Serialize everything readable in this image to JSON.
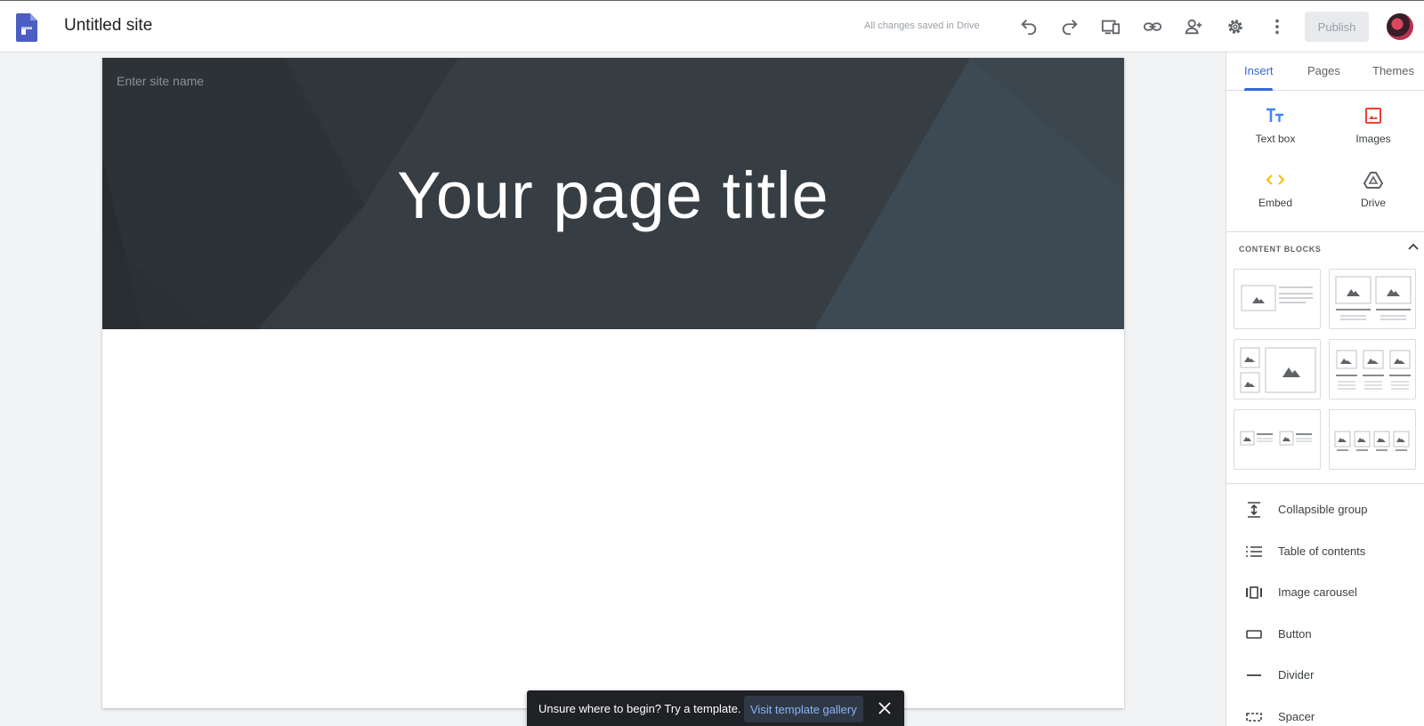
{
  "app": {
    "site_title": "Untitled site",
    "save_status": "All changes saved in Drive",
    "publish_label": "Publish",
    "toolbar_icons": [
      "undo-icon",
      "redo-icon",
      "preview-devices-icon",
      "link-icon",
      "add-person-icon",
      "gear-icon",
      "more-vert-icon"
    ]
  },
  "canvas": {
    "site_name_placeholder": "Enter site name",
    "page_title": "Your page title"
  },
  "panel": {
    "tabs": [
      {
        "label": "Insert",
        "active": true
      },
      {
        "label": "Pages",
        "active": false
      },
      {
        "label": "Themes",
        "active": false
      }
    ],
    "tools": [
      {
        "label": "Text box",
        "icon": "text-box-icon",
        "color": "#4285f4"
      },
      {
        "label": "Images",
        "icon": "image-icon",
        "color": "#ea4335"
      },
      {
        "label": "Embed",
        "icon": "embed-code-icon",
        "color": "#fbbc04"
      },
      {
        "label": "Drive",
        "icon": "drive-icon",
        "color": "#5f6368"
      }
    ],
    "content_blocks_header": "CONTENT BLOCKS",
    "content_block_count": 6,
    "items": [
      {
        "label": "Collapsible group",
        "icon": "collapsible-icon"
      },
      {
        "label": "Table of contents",
        "icon": "list-icon"
      },
      {
        "label": "Image carousel",
        "icon": "carousel-icon"
      },
      {
        "label": "Button",
        "icon": "button-icon"
      },
      {
        "label": "Divider",
        "icon": "divider-icon"
      },
      {
        "label": "Spacer",
        "icon": "spacer-icon"
      }
    ]
  },
  "snackbar": {
    "text": "Unsure where to begin? Try a template.",
    "link": "Visit template gallery"
  },
  "colors": {
    "accent": "#3367d6",
    "header_bg": "#323a40",
    "snackbar_bg": "#202124"
  }
}
